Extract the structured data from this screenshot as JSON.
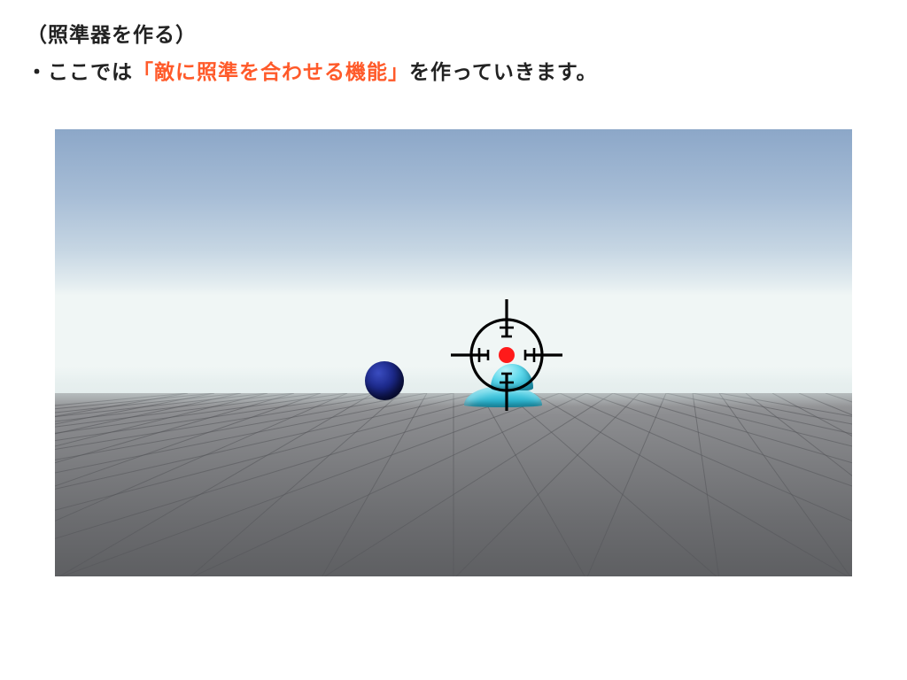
{
  "heading": "（照準器を作る）",
  "subtext": {
    "bullet": "・",
    "prefix": "ここでは",
    "highlight": "「敵に照準を合わせる機能」",
    "suffix": "を作っていきます。"
  },
  "scene": {
    "crosshair_name": "crosshair-reticle",
    "sphere_name": "enemy-sphere",
    "turret_name": "player-turret"
  }
}
